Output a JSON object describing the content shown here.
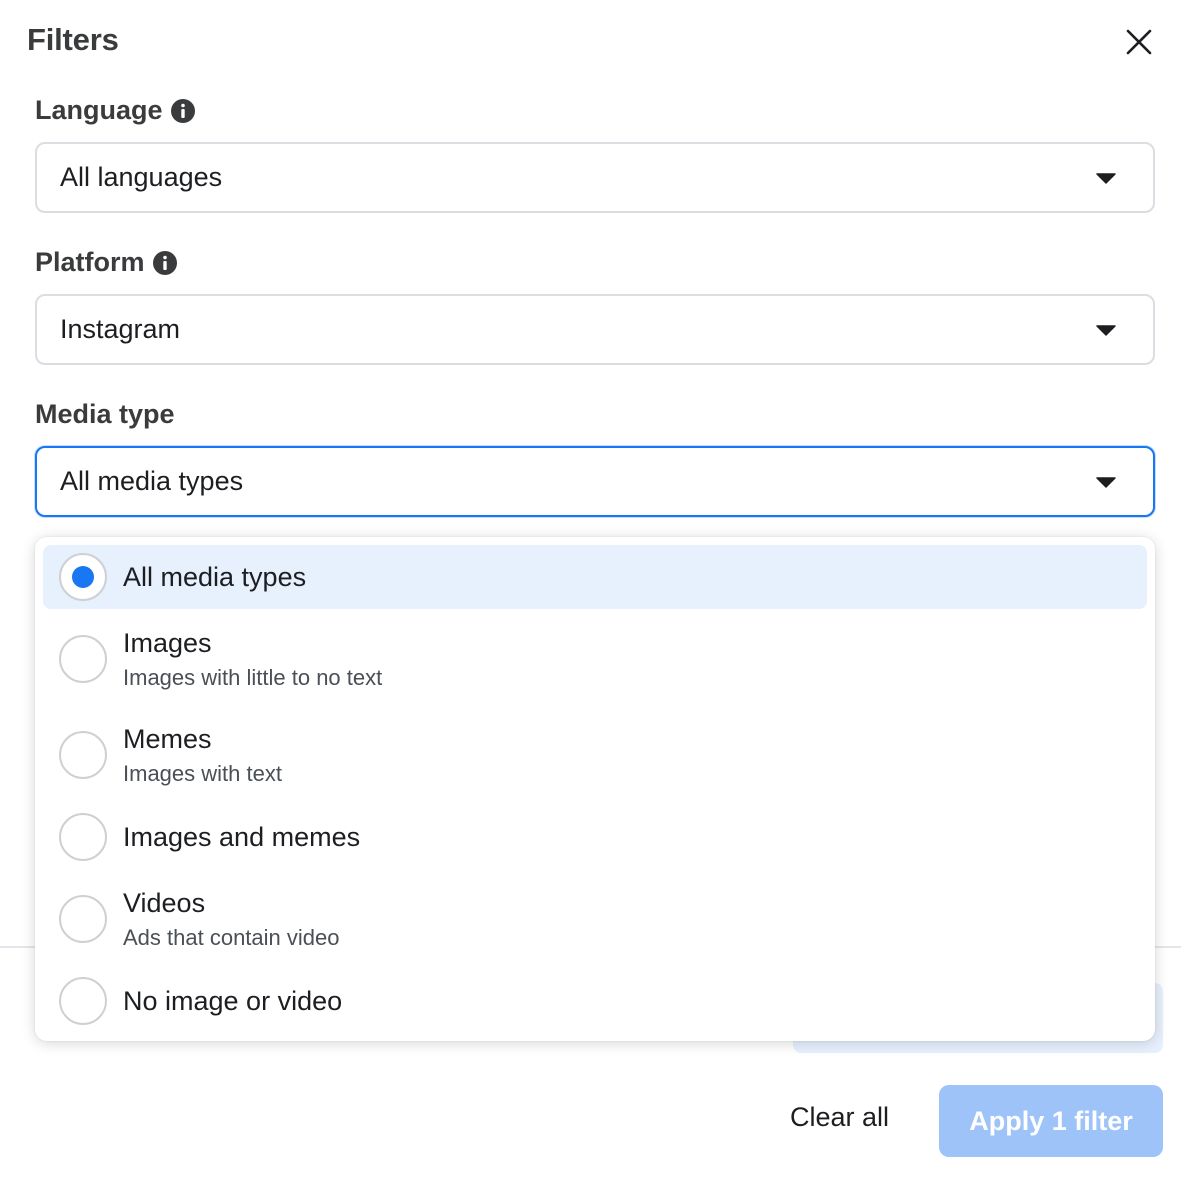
{
  "dialog": {
    "title": "Filters"
  },
  "language": {
    "label": "Language",
    "value": "All languages"
  },
  "platform": {
    "label": "Platform",
    "value": "Instagram"
  },
  "media_type": {
    "label": "Media type",
    "value": "All media types",
    "options": [
      {
        "label": "All media types",
        "description": "",
        "selected": true
      },
      {
        "label": "Images",
        "description": "Images with little to no text",
        "selected": false
      },
      {
        "label": "Memes",
        "description": "Images with text",
        "selected": false
      },
      {
        "label": "Images and memes",
        "description": "",
        "selected": false
      },
      {
        "label": "Videos",
        "description": "Ads that contain video",
        "selected": false
      },
      {
        "label": "No image or video",
        "description": "",
        "selected": false
      }
    ]
  },
  "footer": {
    "clear_label": "Clear all",
    "apply_label": "Apply 1 filter"
  },
  "colors": {
    "accent": "#1877f2",
    "selected_bg": "#e7f0fd",
    "apply_disabled": "#9ec3f8"
  }
}
